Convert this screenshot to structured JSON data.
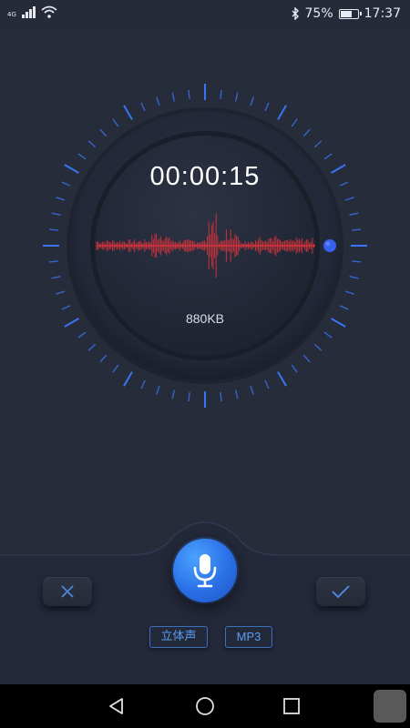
{
  "status_bar": {
    "network": "4G",
    "battery_percent": "75%",
    "battery_level": 0.75,
    "time": "17:37"
  },
  "recorder": {
    "elapsed_time": "00:00:15",
    "file_size": "880KB"
  },
  "controls": {
    "stereo_label": "立体声",
    "format_label": "MP3"
  },
  "colors": {
    "background": "#272c3b",
    "accent_blue": "#2a6fe6",
    "waveform_red": "#e4343c",
    "tick_blue": "#3a78ff"
  },
  "icons": {
    "mic": "microphone-icon",
    "cancel": "x-icon",
    "confirm": "check-icon",
    "bluetooth": "bluetooth-icon",
    "wifi": "wifi-icon"
  }
}
